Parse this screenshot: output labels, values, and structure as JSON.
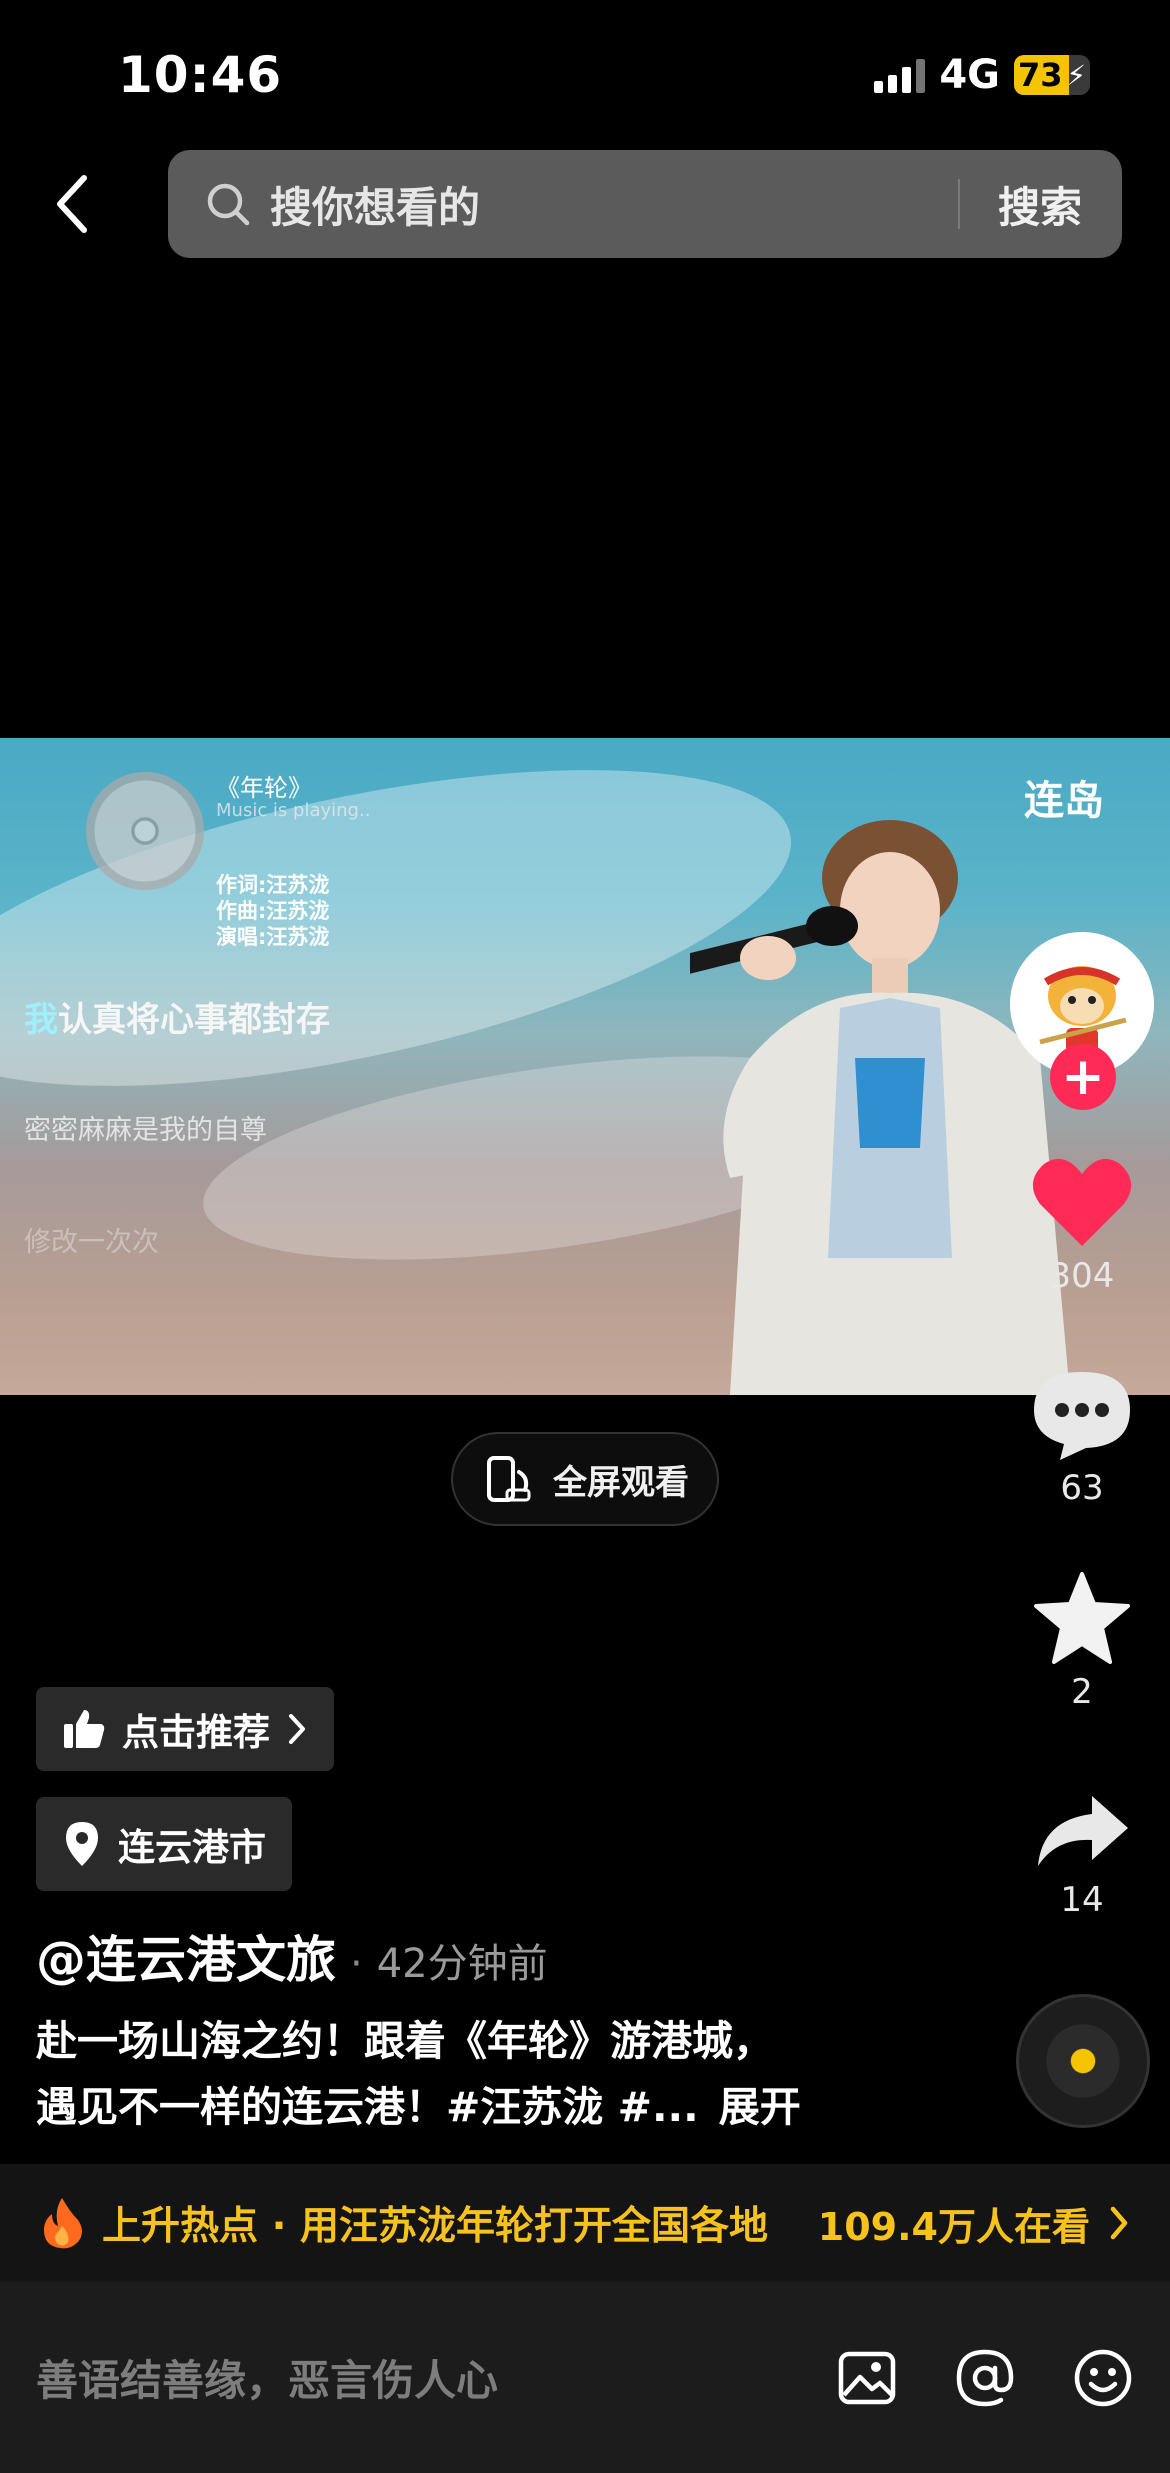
{
  "status_bar": {
    "time": "10:46",
    "network": "4G",
    "battery": "73",
    "battery_level": 0.73
  },
  "search": {
    "placeholder": "搜你想看的",
    "button_label": "搜索"
  },
  "video": {
    "song_title": "《年轮》",
    "song_status": "Music is playing..",
    "credits": [
      "作词:汪苏泷",
      "作曲:汪苏泷",
      "演唱:汪苏泷"
    ],
    "lyric_current_highlight": "我",
    "lyric_current_rest": "认真将心事都封存",
    "lyric_next": "密密麻麻是我的自尊",
    "lyric_faded": "修改一次次",
    "watermark": "连岛"
  },
  "fullscreen": {
    "label": "全屏观看"
  },
  "actions": {
    "likes": "304",
    "comments": "63",
    "favorites": "2",
    "shares": "14"
  },
  "recommend": {
    "label": "点击推荐"
  },
  "location": {
    "label": "连云港市"
  },
  "post": {
    "author": "@连云港文旅",
    "separator": "·",
    "time_ago": "42分钟前",
    "line1": "赴一场山海之约！跟着《年轮》游港城，",
    "line2": "遇见不一样的连云港！#汪苏泷 #...",
    "expand": "展开"
  },
  "hot": {
    "text": "上升热点 · 用汪苏泷年轮打开全国各地",
    "viewers": "109.4万人在看"
  },
  "comment": {
    "placeholder": "善语结善缘，恶言伤人心"
  },
  "colors": {
    "accent_red": "#ff2a55",
    "hot_yellow": "#f7c21c",
    "battery_yellow": "#f5c400"
  }
}
